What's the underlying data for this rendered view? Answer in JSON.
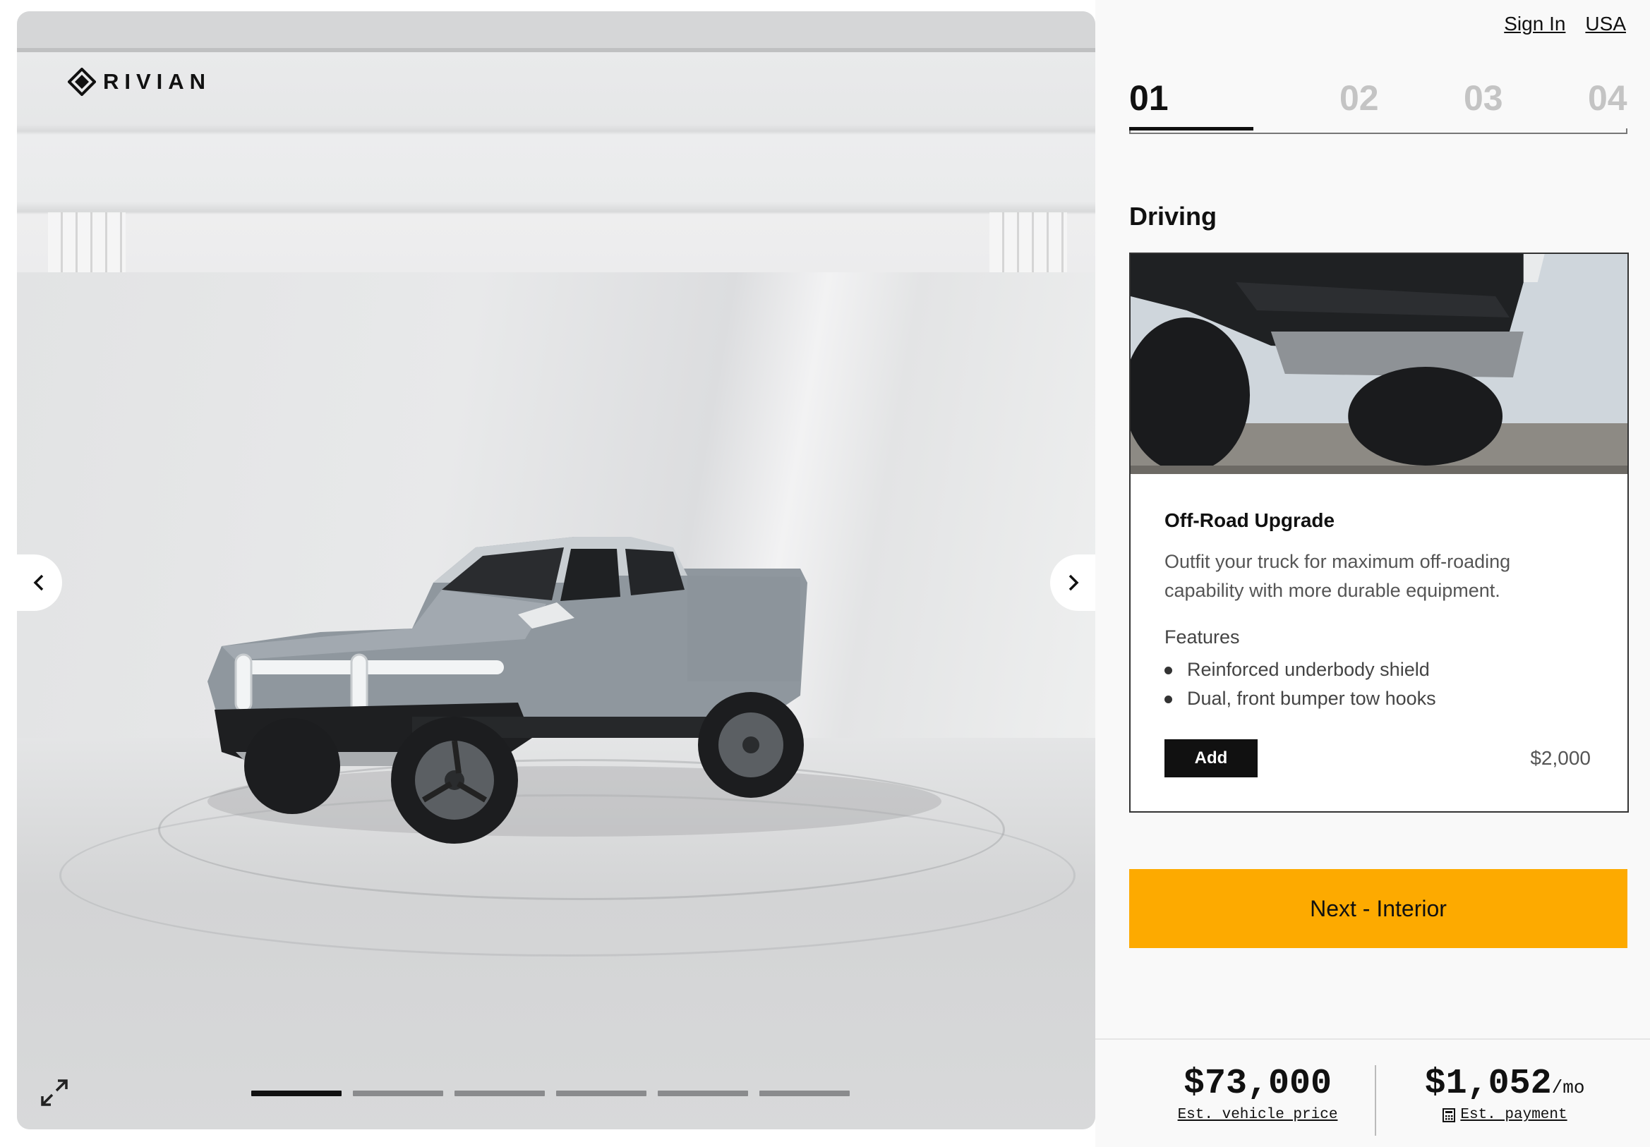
{
  "brand": {
    "name": "RIVIAN"
  },
  "header": {
    "links": [
      {
        "label": "Sign In"
      },
      {
        "label": "USA"
      }
    ]
  },
  "steps": [
    {
      "label": "01",
      "active": true
    },
    {
      "label": "02",
      "active": false
    },
    {
      "label": "03",
      "active": false
    },
    {
      "label": "04",
      "active": false
    }
  ],
  "section": {
    "title": "Driving"
  },
  "option_card": {
    "title": "Off-Road Upgrade",
    "description": "Outfit your truck for maximum off-roading capability with more durable equipment.",
    "features_label": "Features",
    "features": [
      "Reinforced underbody shield",
      "Dual, front bumper tow hooks"
    ],
    "add_label": "Add",
    "price": "$2,000"
  },
  "next_button": {
    "label": "Next - Interior"
  },
  "summary": {
    "vehicle_price": "$73,000",
    "vehicle_price_label": "Est. vehicle price",
    "payment": "$1,052",
    "payment_unit": "/mo",
    "payment_label": "Est. payment"
  },
  "gallery": {
    "slide_count": 6,
    "active_slide": 1,
    "icons": [
      "chevron-left-icon",
      "chevron-right-icon",
      "expand-icon",
      "calculator-icon"
    ]
  },
  "colors": {
    "accent": "#fdaa00",
    "primary": "#111111",
    "inactive_step": "#c4c4c4"
  }
}
